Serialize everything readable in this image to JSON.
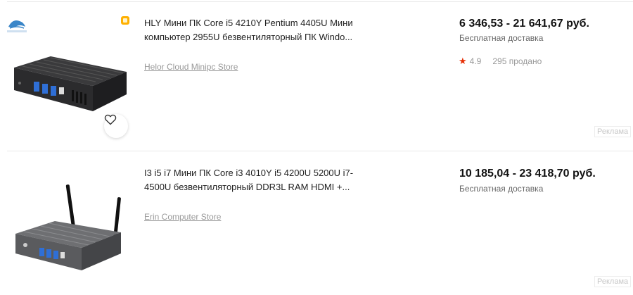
{
  "listings": [
    {
      "title": "HLY Мини ПК Core i5 4210Y Pentium 4405U Мини компьютер 2955U безвентиляторный ПК Windo...",
      "store": "Helor Cloud Minipc Store",
      "price": "6 346,53 - 21 641,67 руб.",
      "shipping": "Бесплатная доставка",
      "rating": "4.9",
      "sold": "295 продано",
      "ad_label": "Реклама",
      "has_brand_logo": true,
      "icons": [
        "brand-logo-icon",
        "promo-tag-icon",
        "heart-icon",
        "star-icon"
      ]
    },
    {
      "title": "I3 i5 i7 Мини ПК Core i3 4010Y i5 4200U 5200U i7-4500U безвентиляторный DDR3L RAM HDMI +...",
      "store": "Erin Computer Store",
      "price": "10 185,04 - 23 418,70 руб.",
      "shipping": "Бесплатная доставка",
      "ad_label": "Реклама"
    }
  ],
  "colors": {
    "accent_star": "#e62e04",
    "promo_tag": "#ffb000",
    "muted_text": "#999999"
  }
}
